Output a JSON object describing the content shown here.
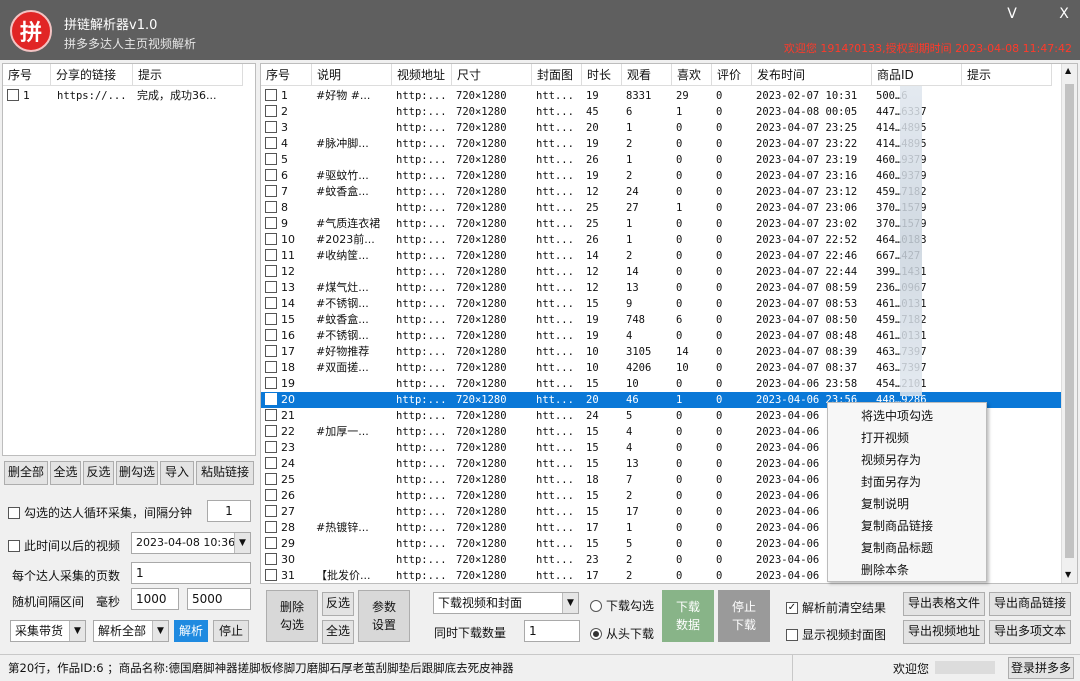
{
  "app": {
    "logo_char": "拼",
    "title": "拼链解析器v1.0",
    "subtitle": "拼多多达人主页视频解析",
    "welcome": "欢迎您 1914?0133,授权到期时间 2023-04-08 11:47:42",
    "minimize": "V",
    "close": "X"
  },
  "left_table": {
    "headers": [
      "序号",
      "分享的链接",
      "提示"
    ],
    "rows": [
      {
        "idx": "1",
        "link": "https://...",
        "tip": "完成，成功36..."
      }
    ]
  },
  "left_buttons": [
    "删全部",
    "全选",
    "反选",
    "删勾选",
    "导入",
    "粘贴链接"
  ],
  "options": {
    "loop_label": "勾选的达人循环采集，间隔分钟",
    "loop_value": "1",
    "after_time_label": "此时间以后的视频",
    "after_time_value": "2023-04-08 10:36",
    "pages_label": "每个达人采集的页数",
    "pages_value": "1",
    "interval_label": "随机间隔区间",
    "ms_label": "毫秒",
    "interval_min": "1000",
    "interval_max": "5000",
    "collect_mode": "采集带货",
    "parse_mode": "解析全部",
    "parse_btn": "解析",
    "stop_btn": "停止"
  },
  "main_table": {
    "headers": [
      "序号",
      "说明",
      "视频地址",
      "尺寸",
      "封面图",
      "时长",
      "观看",
      "喜欢",
      "评价",
      "发布时间",
      "商品ID",
      "提示"
    ],
    "rows": [
      {
        "n": "1",
        "d": "#好物  #...",
        "u": "http:...",
        "s": "720×1280",
        "c": "htt...",
        "len": "19",
        "v": "8331",
        "l": "29",
        "r": "0",
        "t": "2023-02-07 10:31",
        "id": "500…6"
      },
      {
        "n": "2",
        "d": "",
        "u": "http:...",
        "s": "720×1280",
        "c": "htt...",
        "len": "45",
        "v": "6",
        "l": "1",
        "r": "0",
        "t": "2023-04-08 00:05",
        "id": "447…6337"
      },
      {
        "n": "3",
        "d": "",
        "u": "http:...",
        "s": "720×1280",
        "c": "htt...",
        "len": "20",
        "v": "1",
        "l": "0",
        "r": "0",
        "t": "2023-04-07 23:25",
        "id": "414…4895"
      },
      {
        "n": "4",
        "d": "#脉冲脚...",
        "u": "http:...",
        "s": "720×1280",
        "c": "htt...",
        "len": "19",
        "v": "2",
        "l": "0",
        "r": "0",
        "t": "2023-04-07 23:22",
        "id": "414…4895"
      },
      {
        "n": "5",
        "d": "",
        "u": "http:...",
        "s": "720×1280",
        "c": "htt...",
        "len": "26",
        "v": "1",
        "l": "0",
        "r": "0",
        "t": "2023-04-07 23:19",
        "id": "460…9379"
      },
      {
        "n": "6",
        "d": "#驱蚊竹...",
        "u": "http:...",
        "s": "720×1280",
        "c": "htt...",
        "len": "19",
        "v": "2",
        "l": "0",
        "r": "0",
        "t": "2023-04-07 23:16",
        "id": "460…9379"
      },
      {
        "n": "7",
        "d": "#蚊香盒...",
        "u": "http:...",
        "s": "720×1280",
        "c": "htt...",
        "len": "12",
        "v": "24",
        "l": "0",
        "r": "0",
        "t": "2023-04-07 23:12",
        "id": "459…7182"
      },
      {
        "n": "8",
        "d": "",
        "u": "http:...",
        "s": "720×1280",
        "c": "htt...",
        "len": "25",
        "v": "27",
        "l": "1",
        "r": "0",
        "t": "2023-04-07 23:06",
        "id": "370…1579"
      },
      {
        "n": "9",
        "d": "#气质连衣裙",
        "u": "http:...",
        "s": "720×1280",
        "c": "htt...",
        "len": "25",
        "v": "1",
        "l": "0",
        "r": "0",
        "t": "2023-04-07 23:02",
        "id": "370…1579"
      },
      {
        "n": "10",
        "d": "#2023前...",
        "u": "http:...",
        "s": "720×1280",
        "c": "htt...",
        "len": "26",
        "v": "1",
        "l": "0",
        "r": "0",
        "t": "2023-04-07 22:52",
        "id": "464…0183"
      },
      {
        "n": "11",
        "d": "#收纳筐...",
        "u": "http:...",
        "s": "720×1280",
        "c": "htt...",
        "len": "14",
        "v": "2",
        "l": "0",
        "r": "0",
        "t": "2023-04-07 22:46",
        "id": "667…427"
      },
      {
        "n": "12",
        "d": "",
        "u": "http:...",
        "s": "720×1280",
        "c": "htt...",
        "len": "12",
        "v": "14",
        "l": "0",
        "r": "0",
        "t": "2023-04-07 22:44",
        "id": "399…1431"
      },
      {
        "n": "13",
        "d": "#煤气灶...",
        "u": "http:...",
        "s": "720×1280",
        "c": "htt...",
        "len": "12",
        "v": "13",
        "l": "0",
        "r": "0",
        "t": "2023-04-07 08:59",
        "id": "236…0967"
      },
      {
        "n": "14",
        "d": "#不锈钢...",
        "u": "http:...",
        "s": "720×1280",
        "c": "htt...",
        "len": "15",
        "v": "9",
        "l": "0",
        "r": "0",
        "t": "2023-04-07 08:53",
        "id": "461…0131"
      },
      {
        "n": "15",
        "d": "#蚊香盒...",
        "u": "http:...",
        "s": "720×1280",
        "c": "htt...",
        "len": "19",
        "v": "748",
        "l": "6",
        "r": "0",
        "t": "2023-04-07 08:50",
        "id": "459…7182"
      },
      {
        "n": "16",
        "d": "#不锈钢...",
        "u": "http:...",
        "s": "720×1280",
        "c": "htt...",
        "len": "19",
        "v": "4",
        "l": "0",
        "r": "0",
        "t": "2023-04-07 08:48",
        "id": "461…0131"
      },
      {
        "n": "17",
        "d": "#好物推荐",
        "u": "http:...",
        "s": "720×1280",
        "c": "htt...",
        "len": "10",
        "v": "3105",
        "l": "14",
        "r": "0",
        "t": "2023-04-07 08:39",
        "id": "463…7397"
      },
      {
        "n": "18",
        "d": "#双面搓...",
        "u": "http:...",
        "s": "720×1280",
        "c": "htt...",
        "len": "10",
        "v": "4206",
        "l": "10",
        "r": "0",
        "t": "2023-04-07 08:37",
        "id": "463…7397"
      },
      {
        "n": "19",
        "d": "",
        "u": "http:...",
        "s": "720×1280",
        "c": "htt...",
        "len": "15",
        "v": "10",
        "l": "0",
        "r": "0",
        "t": "2023-04-06 23:58",
        "id": "454…2101"
      },
      {
        "n": "20",
        "d": "",
        "u": "http:...",
        "s": "720×1280",
        "c": "htt...",
        "len": "20",
        "v": "46",
        "l": "1",
        "r": "0",
        "t": "2023-04-06 23:56",
        "id": "448…9286"
      },
      {
        "n": "21",
        "d": "",
        "u": "http:...",
        "s": "720×1280",
        "c": "htt...",
        "len": "24",
        "v": "5",
        "l": "0",
        "r": "0",
        "t": "2023-04-06",
        "id": ""
      },
      {
        "n": "22",
        "d": "#加厚一...",
        "u": "http:...",
        "s": "720×1280",
        "c": "htt...",
        "len": "15",
        "v": "4",
        "l": "0",
        "r": "0",
        "t": "2023-04-06",
        "id": ""
      },
      {
        "n": "23",
        "d": "",
        "u": "http:...",
        "s": "720×1280",
        "c": "htt...",
        "len": "15",
        "v": "4",
        "l": "0",
        "r": "0",
        "t": "2023-04-06",
        "id": ""
      },
      {
        "n": "24",
        "d": "",
        "u": "http:...",
        "s": "720×1280",
        "c": "htt...",
        "len": "15",
        "v": "13",
        "l": "0",
        "r": "0",
        "t": "2023-04-06",
        "id": ""
      },
      {
        "n": "25",
        "d": "",
        "u": "http:...",
        "s": "720×1280",
        "c": "htt...",
        "len": "18",
        "v": "7",
        "l": "0",
        "r": "0",
        "t": "2023-04-06",
        "id": ""
      },
      {
        "n": "26",
        "d": "",
        "u": "http:...",
        "s": "720×1280",
        "c": "htt...",
        "len": "15",
        "v": "2",
        "l": "0",
        "r": "0",
        "t": "2023-04-06",
        "id": ""
      },
      {
        "n": "27",
        "d": "",
        "u": "http:...",
        "s": "720×1280",
        "c": "htt...",
        "len": "15",
        "v": "17",
        "l": "0",
        "r": "0",
        "t": "2023-04-06",
        "id": ""
      },
      {
        "n": "28",
        "d": "#热镀锌...",
        "u": "http:...",
        "s": "720×1280",
        "c": "htt...",
        "len": "17",
        "v": "1",
        "l": "0",
        "r": "0",
        "t": "2023-04-06",
        "id": ""
      },
      {
        "n": "29",
        "d": "",
        "u": "http:...",
        "s": "720×1280",
        "c": "htt...",
        "len": "15",
        "v": "5",
        "l": "0",
        "r": "0",
        "t": "2023-04-06",
        "id": ""
      },
      {
        "n": "30",
        "d": "",
        "u": "http:...",
        "s": "720×1280",
        "c": "htt...",
        "len": "23",
        "v": "2",
        "l": "0",
        "r": "0",
        "t": "2023-04-06",
        "id": ""
      },
      {
        "n": "31",
        "d": "【批发价...",
        "u": "http:...",
        "s": "720×1280",
        "c": "htt...",
        "len": "17",
        "v": "2",
        "l": "0",
        "r": "0",
        "t": "2023-04-06",
        "id": ""
      }
    ]
  },
  "context_menu": [
    "将选中项勾选",
    "打开视频",
    "视频另存为",
    "封面另存为",
    "复制说明",
    "复制商品链接",
    "复制商品标题",
    "删除本条"
  ],
  "bottom": {
    "del_checked": "删除\n勾选",
    "invert": "反选",
    "select_all": "全选",
    "params": "参数\n设置",
    "download_type": "下载视频和封面",
    "concurrent_label": "同时下载数量",
    "concurrent_value": "1",
    "radio_checked": "下载勾选",
    "radio_top": "从头下载",
    "download_btn": "下载\n数据",
    "stop_download": "停止\n下载",
    "clear_before": "解析前清空结果",
    "show_cover": "显示视频封面图",
    "export_table": "导出表格文件",
    "export_goods_link": "导出商品链接",
    "export_video_url": "导出视频地址",
    "export_multi_text": "导出多项文本"
  },
  "status": {
    "left": "第20行，作品ID:6          ；商品名称:德国磨脚神器搓脚板修脚刀磨脚石厚老茧刮脚垫后跟脚底去死皮神器",
    "welcome": "欢迎您",
    "login_btn": "登录拼多多"
  },
  "colors": {
    "accent": "#0a78d7",
    "title_bg": "#5f5f5f",
    "logo": "#e12525",
    "welcome_text": "#ff3a2a",
    "download_btn": "#88b488"
  }
}
